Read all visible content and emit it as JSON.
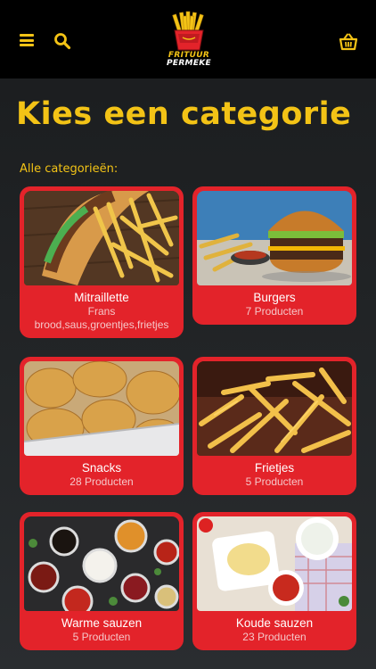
{
  "header": {
    "logo_line1": "FRITUUR",
    "logo_line2": "PERMEKE",
    "menu_icon": "hamburger-menu-icon",
    "search_icon": "search-icon",
    "cart_icon": "shopping-basket-icon"
  },
  "page": {
    "title": "Kies een categorie",
    "section_label": "Alle categorieën:"
  },
  "colors": {
    "accent_yellow": "#f3c316",
    "card_red": "#e3232a",
    "topbar": "#000000"
  },
  "categories": [
    {
      "name": "Mitraillette",
      "subtitle": "Frans brood,saus,groentjes,frietjes",
      "image": "mitraillette-photo"
    },
    {
      "name": "Burgers",
      "subtitle": "7 Producten",
      "image": "burger-photo"
    },
    {
      "name": "Snacks",
      "subtitle": "28 Producten",
      "image": "nuggets-photo"
    },
    {
      "name": "Frietjes",
      "subtitle": "5 Producten",
      "image": "fries-photo"
    },
    {
      "name": "Warme sauzen",
      "subtitle": "5 Producten",
      "image": "warm-sauces-photo"
    },
    {
      "name": "Koude sauzen",
      "subtitle": "23 Producten",
      "image": "cold-sauces-photo"
    }
  ]
}
